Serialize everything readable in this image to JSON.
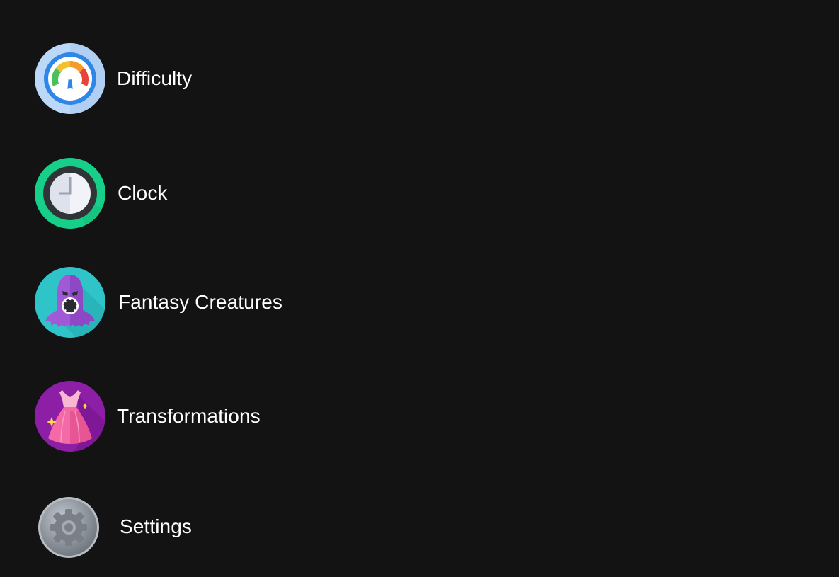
{
  "menu": {
    "items": [
      {
        "label": "Difficulty",
        "icon": "speedometer-icon"
      },
      {
        "label": "Clock",
        "icon": "clock-icon"
      },
      {
        "label": "Fantasy Creatures",
        "icon": "hooded-creature-icon"
      },
      {
        "label": "Transformations",
        "icon": "dress-icon"
      },
      {
        "label": "Settings",
        "icon": "gear-icon"
      }
    ]
  },
  "colors": {
    "background": "#131313",
    "text": "#ffffff",
    "difficulty_bg": "#bcd8f8",
    "difficulty_ring": "#2e86e8",
    "clock_ring": "#16d08a",
    "clock_dark": "#2f3437",
    "creatures_bg": "#2ec4c8",
    "creatures_purple": "#a05ad6",
    "transformations_bg": "#8c1fa6",
    "dress_pink": "#f46aa6",
    "settings_gray": "#8a9099"
  }
}
